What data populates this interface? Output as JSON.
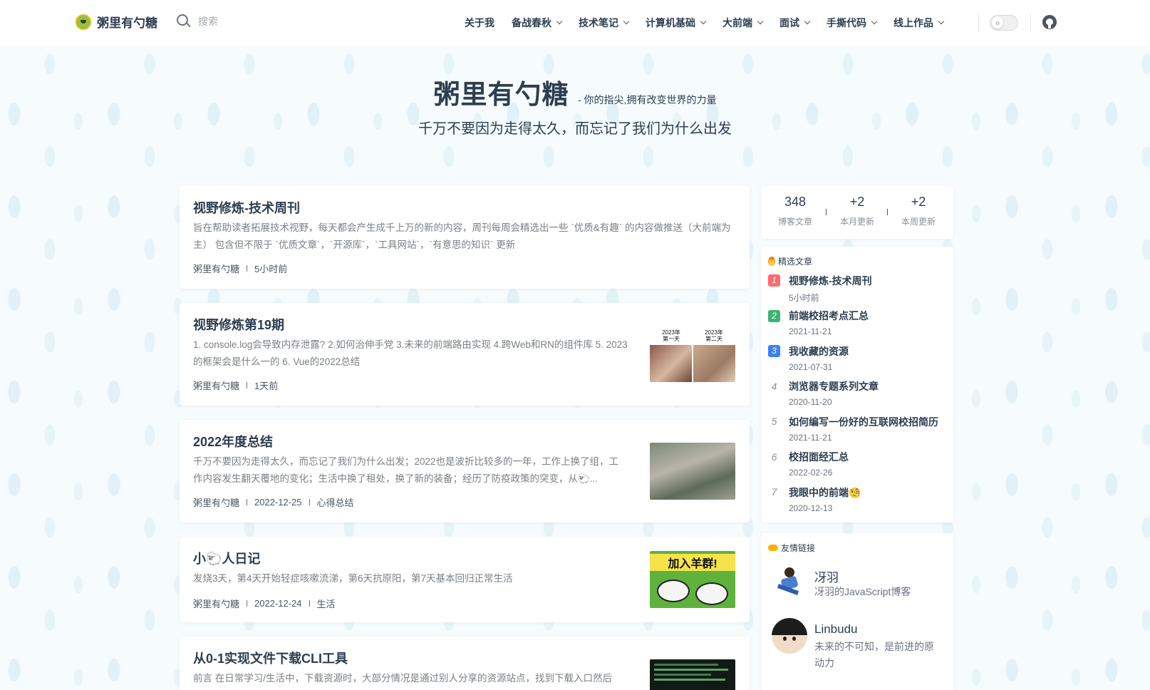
{
  "brand": {
    "name": "粥里有勺糖"
  },
  "search": {
    "placeholder": "搜索"
  },
  "nav": {
    "items": [
      {
        "label": "关于我",
        "dropdown": false
      },
      {
        "label": "备战春秋",
        "dropdown": true
      },
      {
        "label": "技术笔记",
        "dropdown": true
      },
      {
        "label": "计算机基础",
        "dropdown": true
      },
      {
        "label": "大前端",
        "dropdown": true
      },
      {
        "label": "面试",
        "dropdown": true
      },
      {
        "label": "手撕代码",
        "dropdown": true
      },
      {
        "label": "线上作品",
        "dropdown": true
      }
    ]
  },
  "hero": {
    "title": "粥里有勺糖",
    "subtitle": "- 你的指尖,拥有改变世界的力量",
    "tagline": "千万不要因为走得太久，而忘记了我们为什么出发"
  },
  "articles": [
    {
      "title": "视野修炼-技术周刊",
      "desc": "旨在帮助读者拓展技术视野，每天都会产生成千上万的新的内容，周刊每周会精选出一些 `优质&有趣` 的内容做推送（大前端为主） 包含但不限于 `优质文章`，`开源库`，`工具网站`，`有意思的知识` 更新",
      "meta": [
        "粥里有勺糖",
        "5小时前"
      ]
    },
    {
      "title": "视野修炼第19期",
      "desc": "1. console.log会导致内存泄露? 2.如何治伸手党 3.未来的前端路由实现 4.跨Web和RN的组件库 5. 2023的框架会是什么一的 6. Vue的2022总结",
      "meta": [
        "粥里有勺糖",
        "1天前"
      ],
      "thumb_text": [
        "2023年\n第一天",
        "2023年\n第二天"
      ]
    },
    {
      "title": "2022年度总结",
      "desc": "千万不要因为走得太久，而忘记了我们为什么出发；2022也是波折比较多的一年，工作上换了组，工作内容发生翻天覆地的变化；生活中换了租处，换了新的装备；经历了防疫政策的突变，从🐑...",
      "meta": [
        "粥里有勺糖",
        "2022-12-25",
        "心得总结"
      ]
    },
    {
      "title": "小🐑人日记",
      "desc": "发烧3天，第4天开始轻症咳嗽流涕，第6天抗原阳，第7天基本回归正常生活",
      "meta": [
        "粥里有勺糖",
        "2022-12-24",
        "生活"
      ],
      "thumb_text": "加入羊群!"
    },
    {
      "title": "从0-1实现文件下载CLI工具",
      "desc": "前言 在日常学习/生活中，下载资源时，大部分情况是通过别人分享的资源站点，找到下载入口然后",
      "meta": []
    }
  ],
  "stats": [
    {
      "value": "348",
      "label": "博客文章"
    },
    {
      "value": "+2",
      "label": "本月更新"
    },
    {
      "value": "+2",
      "label": "本周更新"
    }
  ],
  "featured": {
    "heading": "精选文章",
    "items": [
      {
        "rank": "1",
        "title": "视野修炼-技术周刊",
        "date": "5小时前",
        "color": "#ff6b6b"
      },
      {
        "rank": "2",
        "title": "前端校招考点汇总",
        "date": "2021-11-21",
        "color": "#3cb371"
      },
      {
        "rank": "3",
        "title": "我收藏的资源",
        "date": "2021-07-31",
        "color": "#3b82f6"
      },
      {
        "rank": "4",
        "title": "浏览器专题系列文章",
        "date": "2020-11-20"
      },
      {
        "rank": "5",
        "title": "如何编写一份好的互联网校招简历",
        "date": "2021-11-21"
      },
      {
        "rank": "6",
        "title": "校招面经汇总",
        "date": "2022-02-26"
      },
      {
        "rank": "7",
        "title": "我眼中的前端🧐",
        "date": "2020-12-13"
      }
    ]
  },
  "friends": {
    "heading": "友情链接",
    "items": [
      {
        "name": "冴羽",
        "desc": "冴羽的JavaScript博客"
      },
      {
        "name": "Linbudu",
        "desc": "未来的不可知，是前进的原动力"
      }
    ]
  }
}
